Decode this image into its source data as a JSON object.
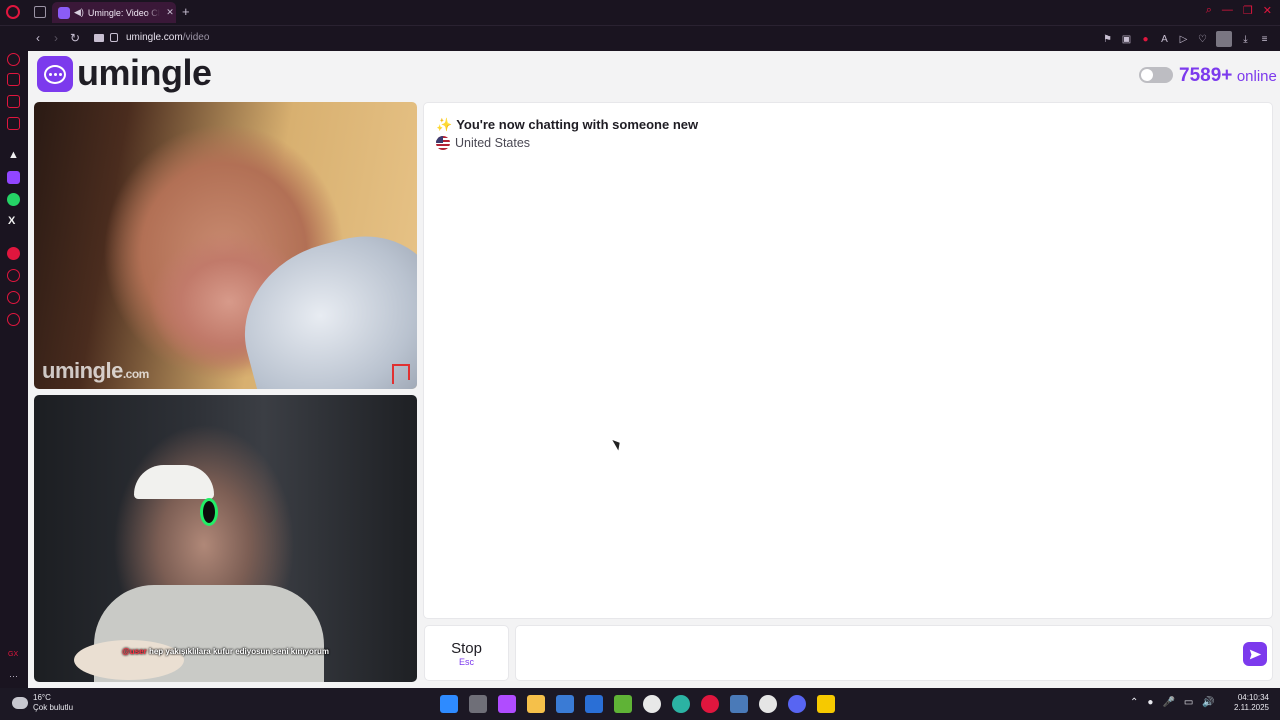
{
  "browser": {
    "tab_title": "Umingle: Video Chat w",
    "url_host": "umingle.com",
    "url_path": "/video"
  },
  "header": {
    "logo_text": "umingle",
    "online_count": "7589+",
    "online_label": "online"
  },
  "stranger_video": {
    "watermark": "umingle",
    "watermark_tld": ".com"
  },
  "self_video": {
    "caption_user": "@user",
    "caption_text": "hep yakışıklılara kufur ediyosun seni kınıyorum"
  },
  "chat": {
    "status": "You're now chatting with someone new",
    "country": "United States",
    "message_placeholder": ""
  },
  "controls": {
    "stop_label": "Stop",
    "stop_key": "Esc"
  },
  "taskbar": {
    "temperature": "16°C",
    "weather": "Çok bulutlu",
    "time": "04:10:34",
    "date": "2.11.2025"
  },
  "colors": {
    "brand": "#7c3aed",
    "browser_accent": "#e0163e"
  }
}
